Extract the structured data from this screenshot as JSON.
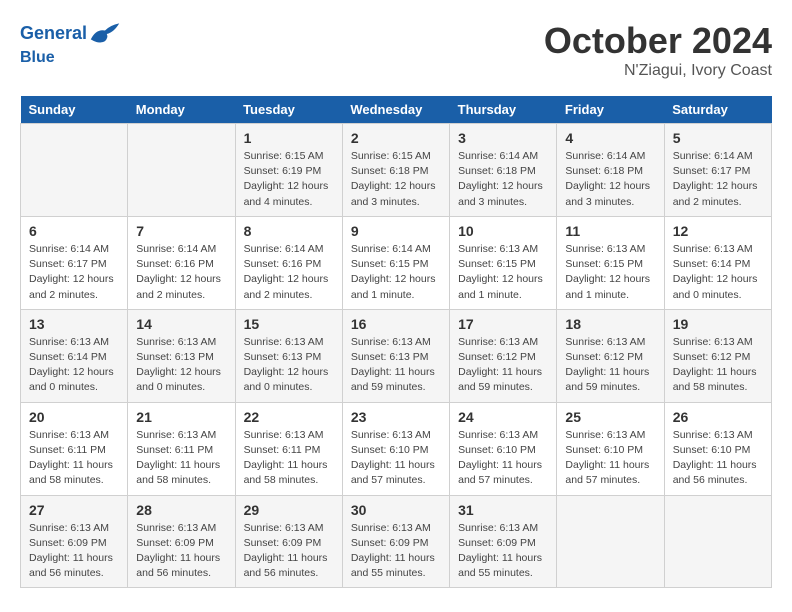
{
  "logo": {
    "line1": "General",
    "line2": "Blue"
  },
  "title": "October 2024",
  "location": "N'Ziagui, Ivory Coast",
  "days_header": [
    "Sunday",
    "Monday",
    "Tuesday",
    "Wednesday",
    "Thursday",
    "Friday",
    "Saturday"
  ],
  "weeks": [
    [
      {
        "num": "",
        "info": ""
      },
      {
        "num": "",
        "info": ""
      },
      {
        "num": "1",
        "info": "Sunrise: 6:15 AM\nSunset: 6:19 PM\nDaylight: 12 hours and 4 minutes."
      },
      {
        "num": "2",
        "info": "Sunrise: 6:15 AM\nSunset: 6:18 PM\nDaylight: 12 hours and 3 minutes."
      },
      {
        "num": "3",
        "info": "Sunrise: 6:14 AM\nSunset: 6:18 PM\nDaylight: 12 hours and 3 minutes."
      },
      {
        "num": "4",
        "info": "Sunrise: 6:14 AM\nSunset: 6:18 PM\nDaylight: 12 hours and 3 minutes."
      },
      {
        "num": "5",
        "info": "Sunrise: 6:14 AM\nSunset: 6:17 PM\nDaylight: 12 hours and 2 minutes."
      }
    ],
    [
      {
        "num": "6",
        "info": "Sunrise: 6:14 AM\nSunset: 6:17 PM\nDaylight: 12 hours and 2 minutes."
      },
      {
        "num": "7",
        "info": "Sunrise: 6:14 AM\nSunset: 6:16 PM\nDaylight: 12 hours and 2 minutes."
      },
      {
        "num": "8",
        "info": "Sunrise: 6:14 AM\nSunset: 6:16 PM\nDaylight: 12 hours and 2 minutes."
      },
      {
        "num": "9",
        "info": "Sunrise: 6:14 AM\nSunset: 6:15 PM\nDaylight: 12 hours and 1 minute."
      },
      {
        "num": "10",
        "info": "Sunrise: 6:13 AM\nSunset: 6:15 PM\nDaylight: 12 hours and 1 minute."
      },
      {
        "num": "11",
        "info": "Sunrise: 6:13 AM\nSunset: 6:15 PM\nDaylight: 12 hours and 1 minute."
      },
      {
        "num": "12",
        "info": "Sunrise: 6:13 AM\nSunset: 6:14 PM\nDaylight: 12 hours and 0 minutes."
      }
    ],
    [
      {
        "num": "13",
        "info": "Sunrise: 6:13 AM\nSunset: 6:14 PM\nDaylight: 12 hours and 0 minutes."
      },
      {
        "num": "14",
        "info": "Sunrise: 6:13 AM\nSunset: 6:13 PM\nDaylight: 12 hours and 0 minutes."
      },
      {
        "num": "15",
        "info": "Sunrise: 6:13 AM\nSunset: 6:13 PM\nDaylight: 12 hours and 0 minutes."
      },
      {
        "num": "16",
        "info": "Sunrise: 6:13 AM\nSunset: 6:13 PM\nDaylight: 11 hours and 59 minutes."
      },
      {
        "num": "17",
        "info": "Sunrise: 6:13 AM\nSunset: 6:12 PM\nDaylight: 11 hours and 59 minutes."
      },
      {
        "num": "18",
        "info": "Sunrise: 6:13 AM\nSunset: 6:12 PM\nDaylight: 11 hours and 59 minutes."
      },
      {
        "num": "19",
        "info": "Sunrise: 6:13 AM\nSunset: 6:12 PM\nDaylight: 11 hours and 58 minutes."
      }
    ],
    [
      {
        "num": "20",
        "info": "Sunrise: 6:13 AM\nSunset: 6:11 PM\nDaylight: 11 hours and 58 minutes."
      },
      {
        "num": "21",
        "info": "Sunrise: 6:13 AM\nSunset: 6:11 PM\nDaylight: 11 hours and 58 minutes."
      },
      {
        "num": "22",
        "info": "Sunrise: 6:13 AM\nSunset: 6:11 PM\nDaylight: 11 hours and 58 minutes."
      },
      {
        "num": "23",
        "info": "Sunrise: 6:13 AM\nSunset: 6:10 PM\nDaylight: 11 hours and 57 minutes."
      },
      {
        "num": "24",
        "info": "Sunrise: 6:13 AM\nSunset: 6:10 PM\nDaylight: 11 hours and 57 minutes."
      },
      {
        "num": "25",
        "info": "Sunrise: 6:13 AM\nSunset: 6:10 PM\nDaylight: 11 hours and 57 minutes."
      },
      {
        "num": "26",
        "info": "Sunrise: 6:13 AM\nSunset: 6:10 PM\nDaylight: 11 hours and 56 minutes."
      }
    ],
    [
      {
        "num": "27",
        "info": "Sunrise: 6:13 AM\nSunset: 6:09 PM\nDaylight: 11 hours and 56 minutes."
      },
      {
        "num": "28",
        "info": "Sunrise: 6:13 AM\nSunset: 6:09 PM\nDaylight: 11 hours and 56 minutes."
      },
      {
        "num": "29",
        "info": "Sunrise: 6:13 AM\nSunset: 6:09 PM\nDaylight: 11 hours and 56 minutes."
      },
      {
        "num": "30",
        "info": "Sunrise: 6:13 AM\nSunset: 6:09 PM\nDaylight: 11 hours and 55 minutes."
      },
      {
        "num": "31",
        "info": "Sunrise: 6:13 AM\nSunset: 6:09 PM\nDaylight: 11 hours and 55 minutes."
      },
      {
        "num": "",
        "info": ""
      },
      {
        "num": "",
        "info": ""
      }
    ]
  ]
}
